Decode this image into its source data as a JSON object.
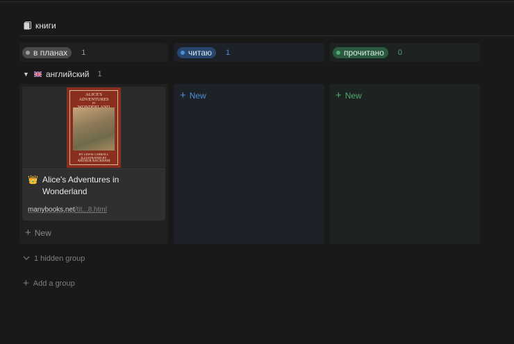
{
  "database": {
    "title": "книги",
    "icon": "page-icon"
  },
  "columns": [
    {
      "label": "в планах",
      "count": "1",
      "new_label": "New",
      "colors": {
        "pill_bg": "#4a4a4a",
        "dot": "#9b9b9b",
        "text": "#e0e0e0",
        "count": "#9b9b9b",
        "bg": "#202020",
        "new": "#8a8a8a"
      }
    },
    {
      "label": "читаю",
      "count": "1",
      "new_label": "New",
      "colors": {
        "pill_bg": "#28456c",
        "dot": "#4d8fd6",
        "text": "#d9e6f5",
        "count": "#4d8fd6",
        "bg": "#1c2228",
        "new": "#4d8fd6"
      }
    },
    {
      "label": "прочитано",
      "count": "0",
      "new_label": "New",
      "colors": {
        "pill_bg": "#2b593f",
        "dot": "#4dab70",
        "text": "#d9efe2",
        "count": "#4dab70",
        "bg": "#1d2320",
        "new": "#4dab70"
      }
    }
  ],
  "group": {
    "name": "английский",
    "flag": "uk-flag-icon",
    "count": "1"
  },
  "card": {
    "emoji": "👑",
    "title": "Alice's Adventures in Wonderland",
    "url_host": "manybooks.net",
    "url_tail": "/tit...8.html",
    "cover": {
      "title_lines": [
        "ALICE'S",
        "ADVENTURES",
        "IN",
        "WONDERLAND"
      ],
      "author_lines": [
        "BY LEWIS CARROLL",
        "ILLUSTRATED BY",
        "ARTHUR RACKHAM"
      ]
    }
  },
  "footer": {
    "hidden_groups": "1 hidden group",
    "add_group": "Add a group"
  }
}
